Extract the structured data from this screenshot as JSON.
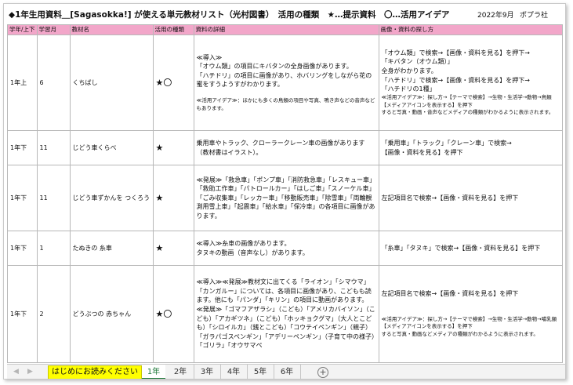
{
  "header": {
    "title": "◆1年生用資料＿[Sagasokka!] が使える単元教材リスト（光村図書）　活用の種類　★…提示資料　〇…活用アイデア",
    "date": "2022年9月",
    "publisher": "ポプラ社"
  },
  "columns": [
    "学年/上下",
    "学習月",
    "教材名",
    "活用の種類",
    "資料の詳細",
    "画像・資料の探し方"
  ],
  "rows": [
    {
      "grade": "1年上",
      "month": "6",
      "name": "くちばし",
      "mark": "★〇",
      "detail": [
        "≪導入≫",
        "「オウム類」の項目にキバタンの全身画像があります。",
        "「ハチドリ」の項目に画像があり、ホバリングをしながら花の蜜をすうようすがわかります。",
        "≪活用アイデア≫：ほかにも多くの鳥類の項目や写真、鳴き声などの音声などもあります。"
      ],
      "howto": [
        "「オウム類」で検索→【画像・資料を見る】を押下→",
        "「キバタン（オウム類）」",
        "全身がわかります。",
        "「ハチドリ」で検索→【画像・資料を見る】を押下→",
        "「ハチドリの1種」",
        "≪活用アイデア≫：探し方→【テーマで検索】→生物・生活学→動物→鳥類　【メディアアイコンを表示する】を押下",
        "すると写真・動画・音声などメディアの種類がわかるように表示されます。"
      ]
    },
    {
      "grade": "1年下",
      "month": "11",
      "name": "じどう車くらべ",
      "mark": "★",
      "detail": [
        "乗用車やトラック、クローラークレーン車の画像があります（教材書はイラスト）。"
      ],
      "howto": [
        "「乗用車」「トラック」「クレーン車」で検索→",
        "【画像・資料を見る】を押下"
      ]
    },
    {
      "grade": "1年下",
      "month": "11",
      "name": "じどう車ずかんを つくろう",
      "mark": "★",
      "detail": [
        "≪発展≫「救急車」「ポンプ車」「消防救急車」「レスキュー車」「救助工作車」「パトロールカー」「はしご車」「スノーケル車」「ごみ収集車」「レッカー車」「移動販売車」「除雪車」「両輪観測用雪上車」「起震車」「給水車」「保冷車」の各項目に画像があります。"
      ],
      "howto": [
        "左記項目名で検索→【画像・資料を見る】を押下"
      ]
    },
    {
      "grade": "1年下",
      "month": "1",
      "name": "たぬきの 糸車",
      "mark": "★",
      "detail": [
        "≪導入≫糸車の画像があります。",
        "タヌキの動画（音声なし）があります。"
      ],
      "howto": [
        "「糸車」「タヌキ」で検索→【画像・資料を見る】を押下"
      ]
    },
    {
      "grade": "1年下",
      "month": "2",
      "name": "どうぶつの 赤ちゃん",
      "mark": "★〇",
      "detail": [
        "≪導入≫≪発展≫教材文に出てくる「ライオン」「シマウマ」「カンガルー」については、各項目に画像があり、こどもも読ます。他にも「パンダ」「キリン」の項目に動画があります。",
        "≪発展≫「ゴマフアザラシ」（こども）「アメリカバイソン」（こども）「アカギツネ」（こども）「ホッキョクグマ」（大人とこども）「シロイルカ」（銭とこども）「コウテイペンギン」（親子）「ガラパゴスペンギン」「アデリーペンギン」（子育て中の様子）「ゴリラ」「オウサマペ"
      ],
      "howto": [
        "左記項目名で検索→【画像・資料を見る】を押下",
        "≪活用アイデア≫：探し方→【テーマで検索】→生物・生活学→動物→哺乳類　【メディアアイコンを表示する】を押下",
        "すると写真・動画などメディアの種類がわかるように表示されます。"
      ]
    }
  ],
  "sheet_tabs": [
    "はじめにお読みください",
    "1年",
    "2年",
    "3年",
    "4年",
    "5年",
    "6年"
  ],
  "active_tab": "1年",
  "icons": {
    "prev": "triangle-left-icon",
    "next": "triangle-right-icon",
    "add": "plus-circle-icon"
  }
}
